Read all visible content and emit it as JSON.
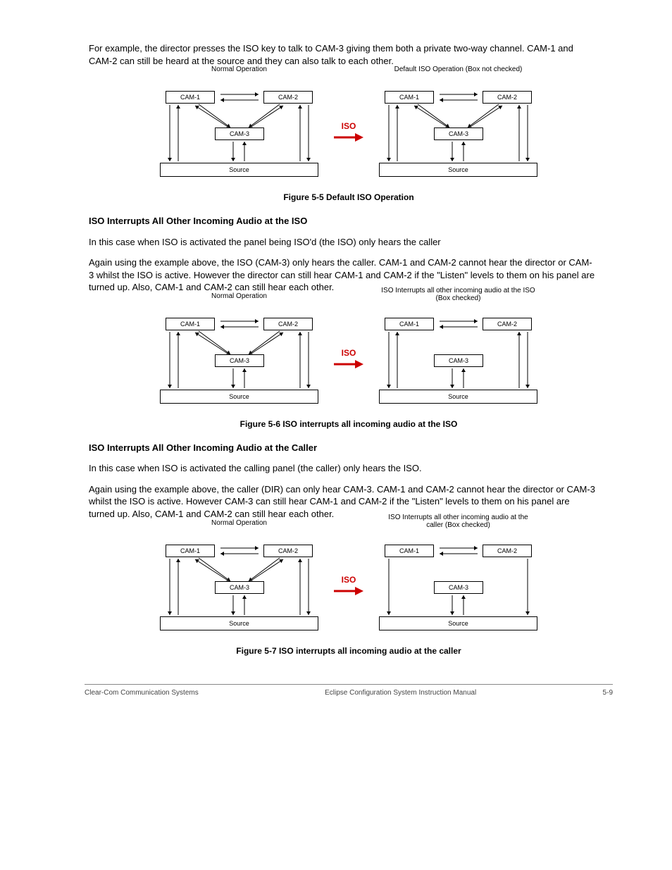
{
  "labels": {
    "cam1": "CAM-1",
    "cam2": "CAM-2",
    "cam3": "CAM-3",
    "source": "Source",
    "normal": "Normal Operation",
    "iso": "ISO"
  },
  "figures": [
    {
      "right_title": "Default ISO Operation (Box not checked)",
      "caption": "Figure 5-5 Default ISO Operation",
      "right_twoline": false,
      "drop_cam12_to_cam3": false,
      "drop_src_to_cam12": false
    },
    {
      "right_title": "ISO Interrupts all other incoming audio at the ISO (Box checked)",
      "caption": "Figure 5-6 ISO interrupts all incoming audio at the ISO",
      "right_twoline": true,
      "drop_cam12_to_cam3": true,
      "drop_src_to_cam12": false
    },
    {
      "right_title": "ISO Interrupts all other incoming audio at the caller (Box checked)",
      "caption": "Figure 5-7 ISO interrupts all incoming audio at the caller",
      "right_twoline": true,
      "drop_cam12_to_cam3": true,
      "drop_src_to_cam12": true
    }
  ],
  "paragraphs": {
    "intro": "For example, the director presses the ISO key to talk to CAM-3 giving them both a private two-way channel. CAM-1 and CAM-2 can still be heard at the source and they can also talk to each other.",
    "b_heading": "ISO Interrupts All Other Incoming Audio at the ISO",
    "b_sentence": "In this case when ISO is activated the panel being ISO'd (the ISO) only hears the caller",
    "b_para": "Again using the example above, the ISO (CAM-3) only hears the caller. CAM-1 and CAM-2 cannot hear the director or CAM-3 whilst the ISO is active. However the director can still hear CAM-1 and CAM-2 if the \"Listen\" levels to them on his panel are turned up. Also, CAM-1 and CAM-2 can still hear each other.",
    "c_heading": "ISO Interrupts All Other Incoming Audio at the Caller",
    "c_sentence": "In this case when ISO is activated the calling panel (the caller) only hears the ISO.",
    "c_para": "Again using the example above, the caller (DIR) can only hear CAM-3. CAM-1 and CAM-2 cannot hear the director or CAM-3 whilst the ISO is active. However CAM-3 can still hear CAM-1 and CAM-2 if the \"Listen\" levels to them on his panel are turned up. Also, CAM-1 and CAM-2 can still hear each other."
  },
  "footer": {
    "left": "Clear-Com Communication Systems",
    "center": "Eclipse Configuration System Instruction Manual",
    "right": "5-9"
  }
}
